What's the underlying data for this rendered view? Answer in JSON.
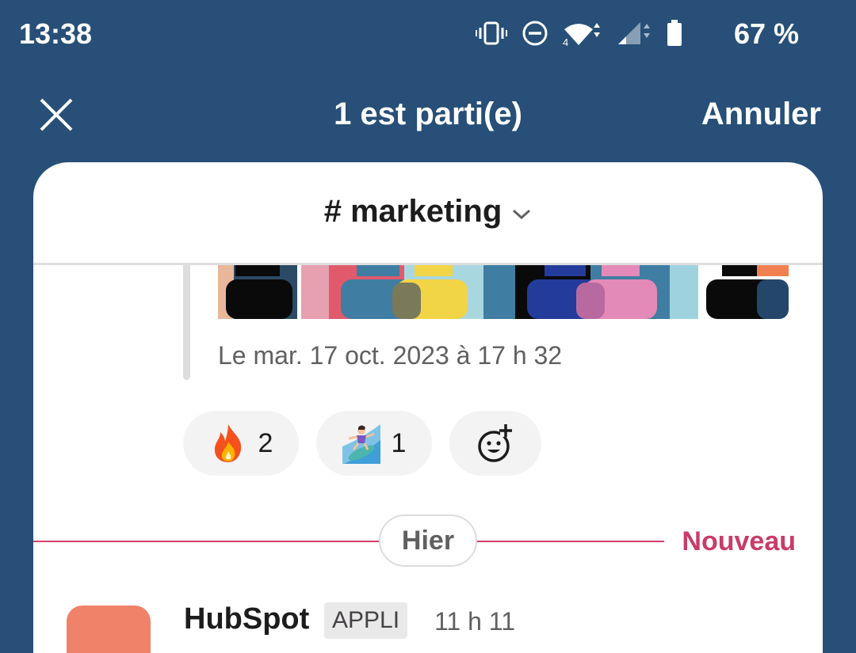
{
  "status_bar": {
    "time": "13:38",
    "battery": "67 %",
    "icons": [
      "vibrate-icon",
      "do-not-disturb-icon",
      "wifi-icon",
      "signal-icon",
      "battery-icon"
    ]
  },
  "top_bar": {
    "title": "1 est parti(e)",
    "cancel_label": "Annuler",
    "close_icon": "close-icon"
  },
  "channel": {
    "name": "# marketing"
  },
  "message": {
    "timestamp": "Le mar. 17 oct. 2023 à 17 h 32"
  },
  "reactions": [
    {
      "emoji": "fire-icon",
      "count": "2"
    },
    {
      "emoji": "surfer-icon",
      "count": "1"
    },
    {
      "emoji": "add-reaction-icon",
      "count": ""
    }
  ],
  "divider": {
    "day": "Hier",
    "new_label": "Nouveau"
  },
  "next_message": {
    "sender": "HubSpot",
    "tag": "APPLI",
    "time": "11 h 11"
  },
  "colors": {
    "background": "#274f77",
    "accent_new": "#c83c67",
    "avatar": "#f0826a"
  }
}
